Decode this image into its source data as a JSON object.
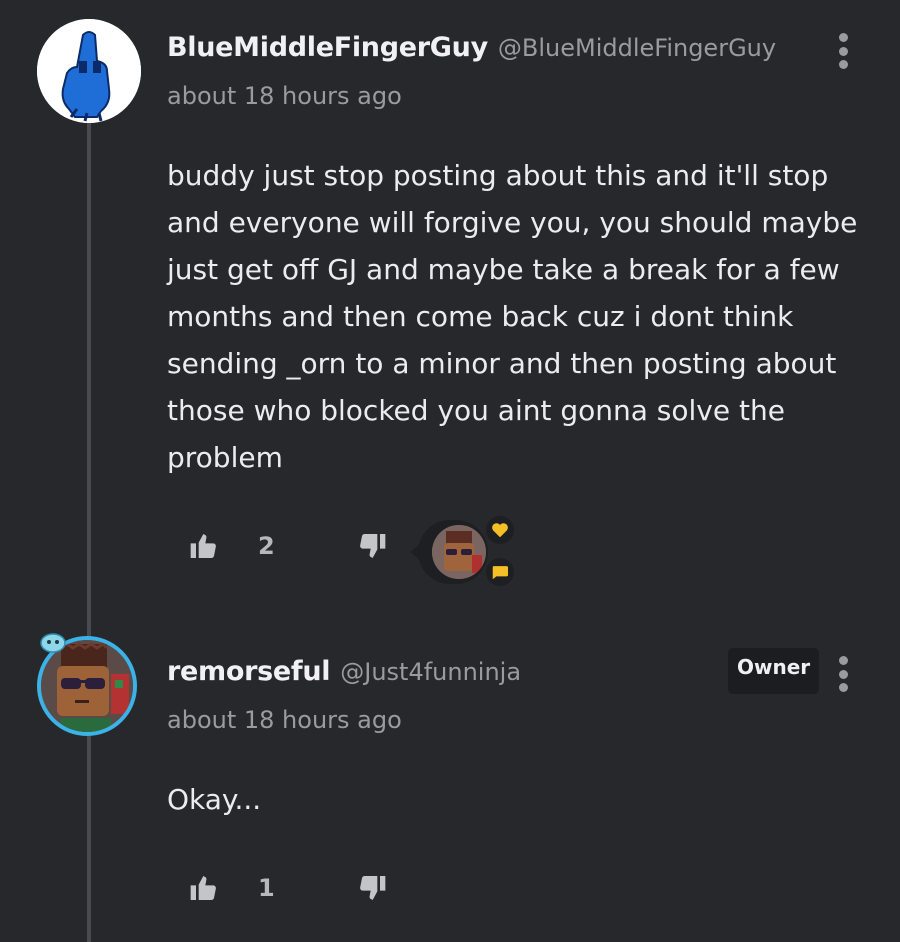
{
  "comments": [
    {
      "username": "BlueMiddleFingerGuy",
      "handle": "@BlueMiddleFingerGuy",
      "time": "about 18 hours ago",
      "body": "buddy just stop posting about this and it'll stop and everyone will forgive you, you should maybe just get off GJ and maybe take a break for a few months and then come back cuz i dont think sending _orn to a minor and then posting about those who blocked you aint gonna solve the problem",
      "likes": "2",
      "has_reactions": true
    },
    {
      "username": "remorseful",
      "handle": "@Just4funninja",
      "time": "about 18 hours ago",
      "badge": "Owner",
      "body": "Okay...",
      "likes": "1"
    }
  ],
  "colors": {
    "background": "#27282c",
    "avatar_ring": "#3bb3e6",
    "reaction_heart": "#f5c026",
    "reaction_chat": "#f5c026"
  },
  "icons": {
    "like": "thumbs-up-icon",
    "dislike": "thumbs-down-icon",
    "menu": "more-vertical-icon",
    "heart": "heart-icon",
    "chat": "chat-bubble-icon"
  }
}
